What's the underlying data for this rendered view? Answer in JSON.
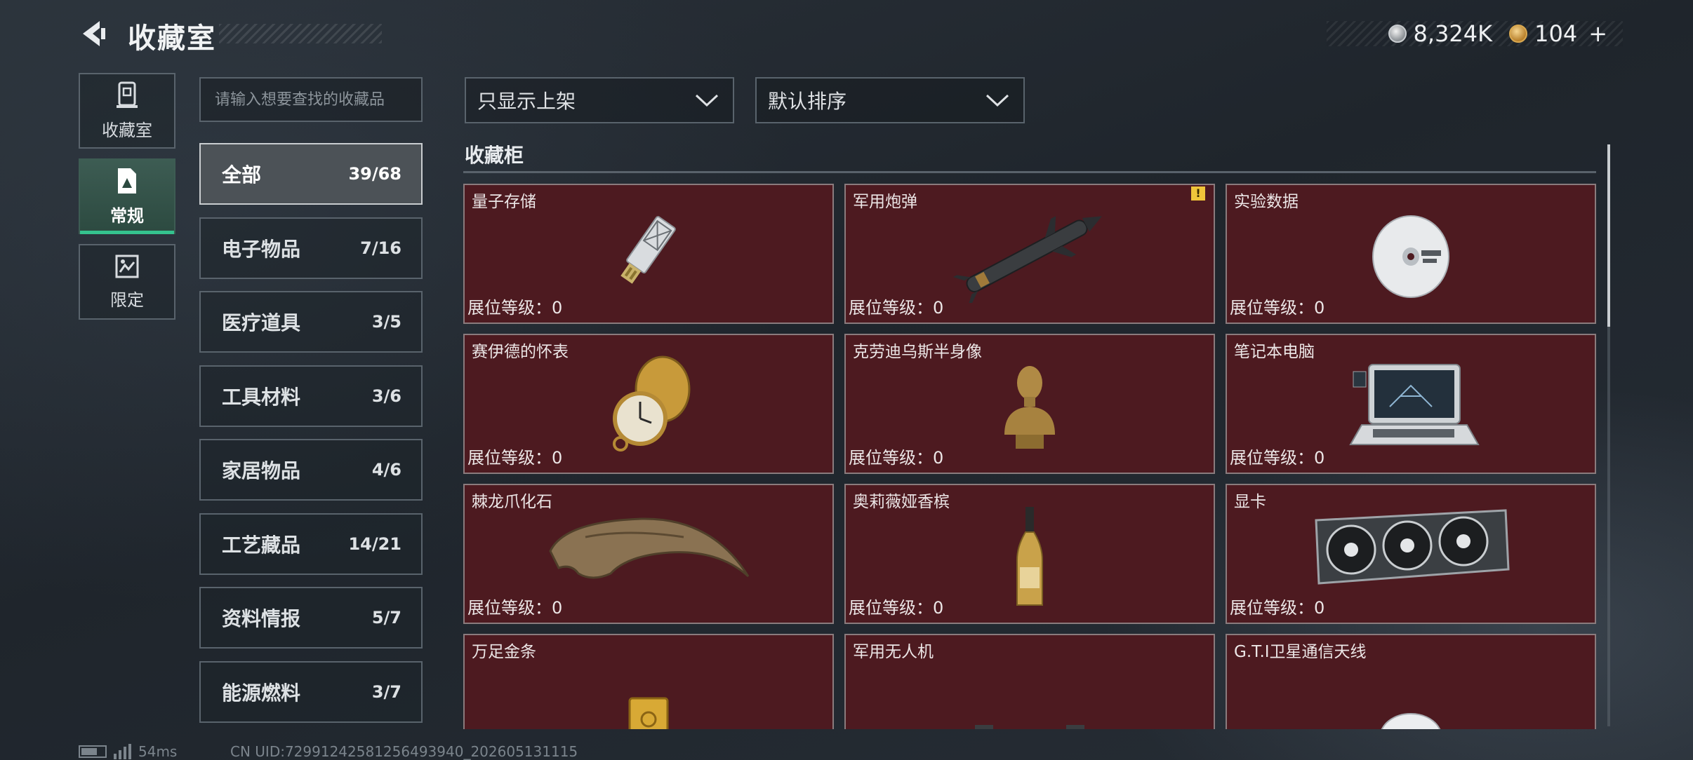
{
  "header": {
    "title": "收藏室",
    "back_icon": "back-arrow-icon",
    "currencies": [
      {
        "icon": "silver-coin-icon",
        "value": "8,324K"
      },
      {
        "icon": "gold-coin-icon",
        "value": "104",
        "add_label": "+"
      }
    ]
  },
  "left_nav": [
    {
      "label": "收藏室",
      "icon": "collection-room-icon",
      "active": false
    },
    {
      "label": "常规",
      "icon": "regular-card-icon",
      "active": true
    },
    {
      "label": "限定",
      "icon": "limited-icon",
      "active": false
    }
  ],
  "search": {
    "placeholder": "请输入想要查找的收藏品"
  },
  "categories": [
    {
      "name": "全部",
      "count": "39/68",
      "active": true
    },
    {
      "name": "电子物品",
      "count": "7/16"
    },
    {
      "name": "医疗道具",
      "count": "3/5"
    },
    {
      "name": "工具材料",
      "count": "3/6"
    },
    {
      "name": "家居物品",
      "count": "4/6"
    },
    {
      "name": "工艺藏品",
      "count": "14/21"
    },
    {
      "name": "资料情报",
      "count": "5/7"
    },
    {
      "name": "能源燃料",
      "count": "3/7"
    }
  ],
  "filters": {
    "show_filter": "只显示上架",
    "sort": "默认排序"
  },
  "section": {
    "title": "收藏柜"
  },
  "items": [
    {
      "name": "量子存储",
      "level_label": "展位等级：0",
      "icon": "usb-drive-icon"
    },
    {
      "name": "军用炮弹",
      "level_label": "展位等级：0",
      "icon": "missile-icon",
      "badge": "!"
    },
    {
      "name": "实验数据",
      "level_label": "展位等级：0",
      "icon": "disc-icon"
    },
    {
      "name": "赛伊德的怀表",
      "level_label": "展位等级：0",
      "icon": "pocket-watch-icon"
    },
    {
      "name": "克劳迪乌斯半身像",
      "level_label": "展位等级：0",
      "icon": "bust-icon"
    },
    {
      "name": "笔记本电脑",
      "level_label": "展位等级：0",
      "icon": "laptop-icon"
    },
    {
      "name": "棘龙爪化石",
      "level_label": "展位等级：0",
      "icon": "claw-fossil-icon"
    },
    {
      "name": "奥莉薇娅香槟",
      "level_label": "展位等级：0",
      "icon": "champagne-icon"
    },
    {
      "name": "显卡",
      "level_label": "展位等级：0",
      "icon": "graphics-card-icon"
    },
    {
      "name": "万足金条",
      "level_label": "",
      "icon": "gold-bar-icon"
    },
    {
      "name": "军用无人机",
      "level_label": "",
      "icon": "drone-icon"
    },
    {
      "name": "G.T.I卫星通信天线",
      "level_label": "",
      "icon": "satellite-dish-icon"
    }
  ],
  "footer": {
    "ping": "54ms",
    "uid": "CN UID:72991242581256493940_202605131115"
  },
  "colors": {
    "accent": "#35c28e",
    "card_bg": "#4d1a20",
    "panel_border": "#59636c"
  }
}
